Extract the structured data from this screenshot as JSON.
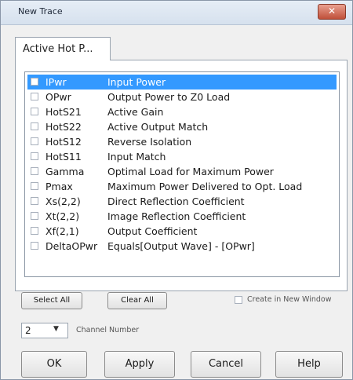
{
  "window": {
    "title": "New Trace",
    "close_glyph": "✕"
  },
  "tab": {
    "label": "Active Hot P..."
  },
  "traces": [
    {
      "abbr": "IPwr",
      "desc": "Input Power",
      "selected": true
    },
    {
      "abbr": "OPwr",
      "desc": "Output Power to Z0 Load",
      "selected": false
    },
    {
      "abbr": "HotS21",
      "desc": "Active Gain",
      "selected": false
    },
    {
      "abbr": "HotS22",
      "desc": "Active Output Match",
      "selected": false
    },
    {
      "abbr": "HotS12",
      "desc": "Reverse Isolation",
      "selected": false
    },
    {
      "abbr": "HotS11",
      "desc": "Input Match",
      "selected": false
    },
    {
      "abbr": "Gamma",
      "desc": "Optimal Load for Maximum Power",
      "selected": false
    },
    {
      "abbr": "Pmax",
      "desc": "Maximum Power Delivered to Opt. Load",
      "selected": false
    },
    {
      "abbr": "Xs(2,2)",
      "desc": "Direct Reflection Coefficient",
      "selected": false
    },
    {
      "abbr": "Xt(2,2)",
      "desc": "Image Reflection Coefficient",
      "selected": false
    },
    {
      "abbr": "Xf(2,1)",
      "desc": "Output Coefficient",
      "selected": false
    },
    {
      "abbr": "DeltaOPwr",
      "desc": "Equals[Output Wave] - [OPwr]",
      "selected": false
    }
  ],
  "list_actions": {
    "select_all": "Select All",
    "clear_all": "Clear All"
  },
  "new_window": {
    "label": "Create in New Window",
    "checked": false
  },
  "channel": {
    "value": "2",
    "label": "Channel Number"
  },
  "footer": {
    "ok": "OK",
    "apply": "Apply",
    "cancel": "Cancel",
    "help": "Help"
  },
  "colors": {
    "selection": "#3399ff",
    "close_button": "#c0503a",
    "dialog_background": "#f0f0f0"
  }
}
